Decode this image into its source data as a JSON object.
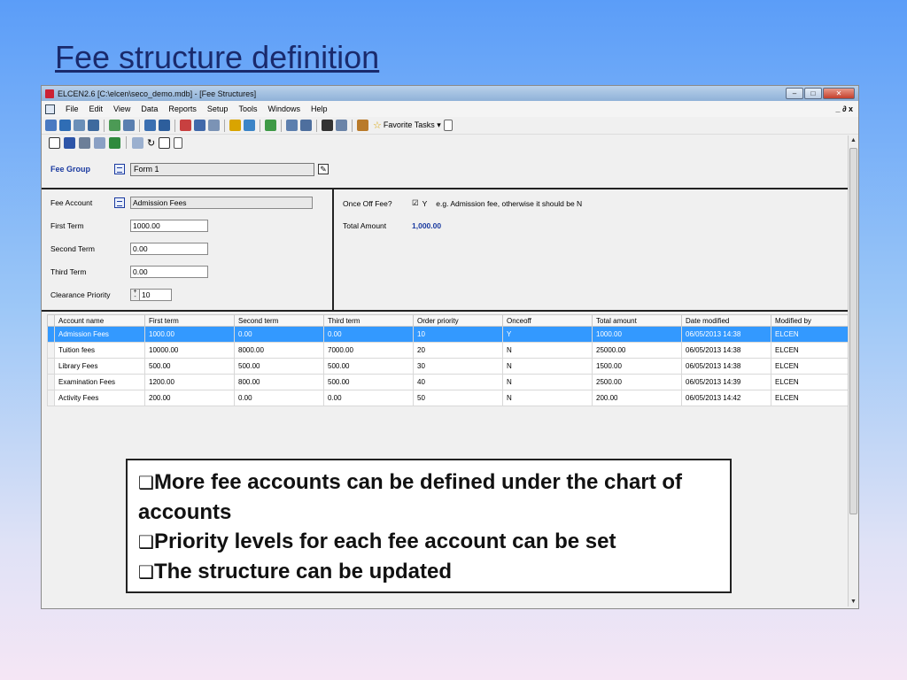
{
  "slide": {
    "title": "Fee structure definition"
  },
  "window": {
    "title": "ELCEN2.6 [C:\\elcen\\seco_demo.mdb] - [Fee Structures]"
  },
  "menu": [
    "File",
    "Edit",
    "View",
    "Data",
    "Reports",
    "Setup",
    "Tools",
    "Windows",
    "Help"
  ],
  "menu_right": "_ ∂ x",
  "toolbar": {
    "favorite_tasks": "Favorite Tasks ▾"
  },
  "fee_group": {
    "label": "Fee Group",
    "value": "Form 1"
  },
  "detail": {
    "fee_account_label": "Fee Account",
    "fee_account_value": "Admission Fees",
    "first_term_label": "First Term",
    "first_term_value": "1000.00",
    "second_term_label": "Second Term",
    "second_term_value": "0.00",
    "third_term_label": "Third Term",
    "third_term_value": "0.00",
    "clearance_priority_label": "Clearance Priority",
    "clearance_priority_value": "10",
    "once_off_label": "Once Off Fee?",
    "once_off_check": "☑",
    "once_off_value": "Y",
    "once_off_hint": "e.g. Admission fee, otherwise it should be N",
    "total_amount_label": "Total Amount",
    "total_amount_value": "1,000.00"
  },
  "grid": {
    "columns": [
      "Account name",
      "First term",
      "Second term",
      "Third term",
      "Order priority",
      "Onceoff",
      "Total amount",
      "Date modified",
      "Modified by"
    ],
    "rows": [
      [
        "Admission Fees",
        "1000.00",
        "0.00",
        "0.00",
        "10",
        "Y",
        "1000.00",
        "06/05/2013 14:38",
        "ELCEN"
      ],
      [
        "Tuition fees",
        "10000.00",
        "8000.00",
        "7000.00",
        "20",
        "N",
        "25000.00",
        "06/05/2013 14:38",
        "ELCEN"
      ],
      [
        "Library Fees",
        "500.00",
        "500.00",
        "500.00",
        "30",
        "N",
        "1500.00",
        "06/05/2013 14:38",
        "ELCEN"
      ],
      [
        "Examination Fees",
        "1200.00",
        "800.00",
        "500.00",
        "40",
        "N",
        "2500.00",
        "06/05/2013 14:39",
        "ELCEN"
      ],
      [
        "Activity Fees",
        "200.00",
        "0.00",
        "0.00",
        "50",
        "N",
        "200.00",
        "06/05/2013 14:42",
        "ELCEN"
      ]
    ]
  },
  "notes": {
    "bullet": "❑",
    "line1": "More fee accounts can be defined under the chart of accounts",
    "line2": "Priority levels for each fee account can be set",
    "line3": "The structure can be updated"
  }
}
